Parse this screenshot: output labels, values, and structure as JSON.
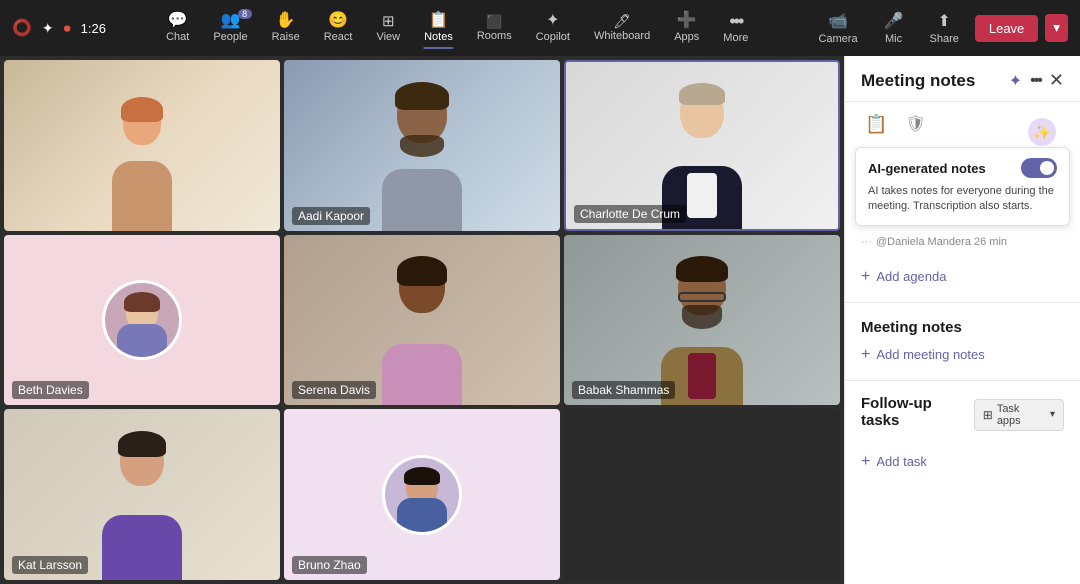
{
  "topbar": {
    "timer": "1:26",
    "nav": [
      {
        "id": "chat",
        "label": "Chat",
        "icon": "💬",
        "badge": null,
        "active": false
      },
      {
        "id": "people",
        "label": "People",
        "icon": "👥",
        "badge": "8",
        "active": false
      },
      {
        "id": "raise",
        "label": "Raise",
        "icon": "✋",
        "badge": null,
        "active": false
      },
      {
        "id": "react",
        "label": "React",
        "icon": "😊",
        "badge": null,
        "active": false
      },
      {
        "id": "view",
        "label": "View",
        "icon": "⊞",
        "badge": null,
        "active": false
      },
      {
        "id": "notes",
        "label": "Notes",
        "icon": "📋",
        "badge": null,
        "active": true
      },
      {
        "id": "rooms",
        "label": "Rooms",
        "icon": "⬛",
        "badge": null,
        "active": false
      },
      {
        "id": "copilot",
        "label": "Copilot",
        "icon": "✦",
        "badge": null,
        "active": false
      },
      {
        "id": "whiteboard",
        "label": "Whiteboard",
        "icon": "🖊",
        "badge": null,
        "active": false
      },
      {
        "id": "apps",
        "label": "Apps",
        "icon": "➕",
        "badge": null,
        "active": false
      },
      {
        "id": "more",
        "label": "More",
        "icon": "•••",
        "badge": null,
        "active": false
      }
    ],
    "camera_label": "Camera",
    "mic_label": "Mic",
    "share_label": "Share",
    "leave_label": "Leave"
  },
  "participants": [
    {
      "id": "p1",
      "name": "",
      "bg": "warm",
      "row": 1,
      "col": 1,
      "active": false
    },
    {
      "id": "p2",
      "name": "Aadi Kapoor",
      "bg": "office",
      "row": 1,
      "col": 2,
      "active": false
    },
    {
      "id": "p3",
      "name": "Charlotte De Crum",
      "bg": "white",
      "row": 1,
      "col": 3,
      "active": true
    },
    {
      "id": "p4",
      "name": "Beth Davies",
      "bg": "pink",
      "row": 2,
      "col": 1,
      "active": false
    },
    {
      "id": "p5",
      "name": "Serena Davis",
      "bg": "bookshelf",
      "row": 2,
      "col": 2,
      "active": false
    },
    {
      "id": "p6",
      "name": "Babak Shammas",
      "bg": "office2",
      "row": 2,
      "col": 3,
      "active": false
    },
    {
      "id": "p7",
      "name": "Kat Larsson",
      "bg": "officelight",
      "row": 3,
      "col": 1,
      "active": false
    },
    {
      "id": "p8",
      "name": "Bruno Zhao",
      "bg": "pink",
      "row": 3,
      "col": 2,
      "active": false
    }
  ],
  "side_panel": {
    "title": "Meeting notes",
    "ai_toggle_label": "AI-generated notes",
    "ai_description": "AI takes notes for everyone during the meeting. Transcription also starts.",
    "agenda_label": "Add agenda",
    "scrolled_text": "@Daniela Mandera 26 min",
    "meeting_notes_label": "Meeting notes",
    "add_notes_label": "Add meeting notes",
    "follow_up_label": "Follow-up tasks",
    "task_apps_label": "Task apps",
    "add_task_label": "Add task"
  }
}
